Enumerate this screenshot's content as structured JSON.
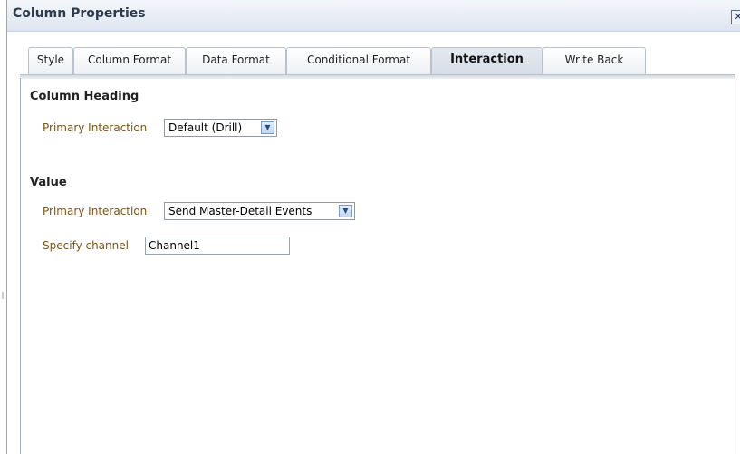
{
  "dialog": {
    "title": "Column Properties",
    "close_glyph": "✕"
  },
  "tabs": [
    {
      "label": "Style",
      "active": false
    },
    {
      "label": "Column Format",
      "active": false
    },
    {
      "label": "Data Format",
      "active": false
    },
    {
      "label": "Conditional Format",
      "active": false
    },
    {
      "label": "Interaction",
      "active": true
    },
    {
      "label": "Write Back",
      "active": false
    }
  ],
  "column_heading": {
    "section_title": "Column Heading",
    "primary_interaction_label": "Primary Interaction",
    "primary_interaction_value": "Default (Drill)"
  },
  "value": {
    "section_title": "Value",
    "primary_interaction_label": "Primary Interaction",
    "primary_interaction_value": "Send Master-Detail Events",
    "channel_label": "Specify channel",
    "channel_value": "Channel1"
  },
  "icons": {
    "close": "close-icon",
    "dropdown": "chevron-down-icon"
  },
  "colors": {
    "label_text": "#7a5413",
    "title_text": "#2b3a4d",
    "active_tab": "#d7dee7"
  }
}
